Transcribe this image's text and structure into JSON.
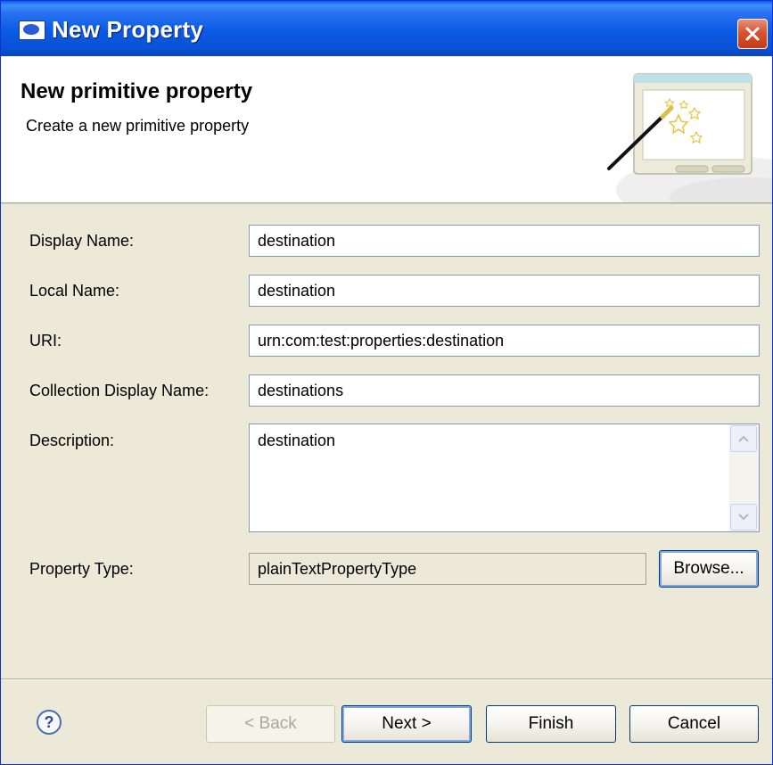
{
  "window": {
    "title": "New Property"
  },
  "header": {
    "title": "New primitive property",
    "description": "Create a new primitive property"
  },
  "form": {
    "display_name": {
      "label": "Display Name:",
      "value": "destination"
    },
    "local_name": {
      "label": "Local Name:",
      "value": "destination"
    },
    "uri": {
      "label": "URI:",
      "value": "urn:com:test:properties:destination"
    },
    "collection_display_name": {
      "label": "Collection Display Name:",
      "value": "destinations"
    },
    "description": {
      "label": "Description:",
      "value": "destination"
    },
    "property_type": {
      "label": "Property Type:",
      "value": "plainTextPropertyType",
      "browse_label": "Browse..."
    }
  },
  "footer": {
    "help_glyph": "?",
    "back_label": "< Back",
    "next_label": "Next >",
    "finish_label": "Finish",
    "cancel_label": "Cancel"
  },
  "colors": {
    "titlebar": "#0a52d6",
    "close": "#d8532f",
    "dialog_bg": "#ece9d8",
    "field_border": "#7f9db9"
  },
  "icons": {
    "app": "hp-logo-icon",
    "close": "close-icon",
    "wizard": "magic-wand-icon",
    "help": "help-icon"
  }
}
